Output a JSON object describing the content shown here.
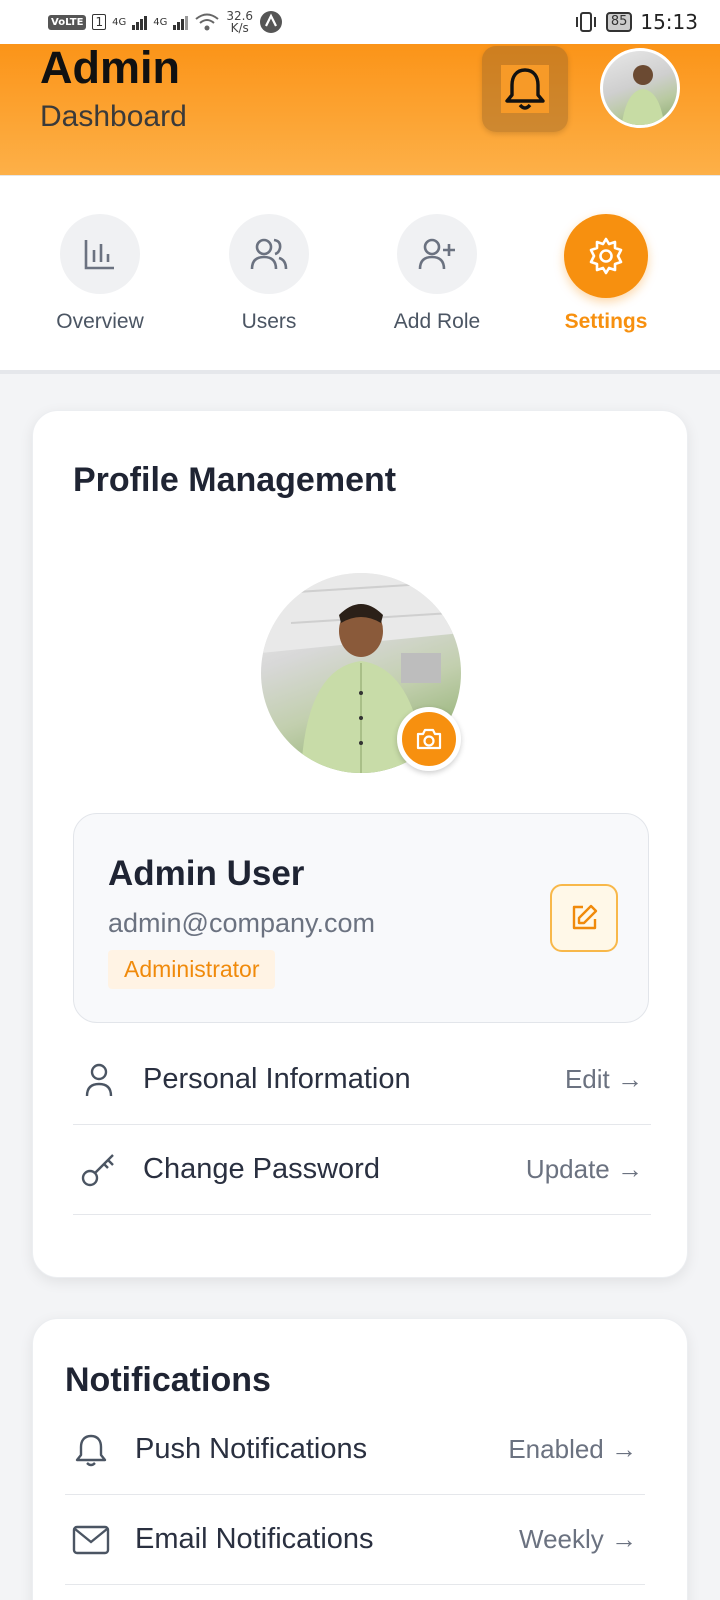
{
  "status_bar": {
    "volte": "VoLTE",
    "sim1": "4G",
    "sim2": "4G",
    "net_speed": "32.6",
    "net_unit": "K/s",
    "battery": "85",
    "time": "15:13"
  },
  "header": {
    "title": "Admin",
    "subtitle": "Dashboard"
  },
  "tabs": [
    {
      "label": "Overview",
      "icon": "bar-chart-icon",
      "active": false
    },
    {
      "label": "Users",
      "icon": "users-icon",
      "active": false
    },
    {
      "label": "Add Role",
      "icon": "user-plus-icon",
      "active": false
    },
    {
      "label": "Settings",
      "icon": "gear-icon",
      "active": true
    }
  ],
  "profile": {
    "section_title": "Profile Management",
    "name": "Admin User",
    "email": "admin@company.com",
    "role": "Administrator",
    "rows": [
      {
        "label": "Personal Information",
        "action": "Edit →",
        "icon": "user-icon"
      },
      {
        "label": "Change Password",
        "action": "Update →",
        "icon": "key-icon"
      }
    ]
  },
  "notifications": {
    "section_title": "Notifications",
    "rows": [
      {
        "label": "Push Notifications",
        "action": "Enabled →",
        "icon": "bell-icon"
      },
      {
        "label": "Email Notifications",
        "action": "Weekly →",
        "icon": "mail-icon"
      }
    ]
  },
  "colors": {
    "accent": "#f7900f",
    "header_gradient_top": "#fb9418",
    "header_gradient_bottom": "#fdb048",
    "text_dark": "#1f2433",
    "text_muted": "#6b7280"
  }
}
